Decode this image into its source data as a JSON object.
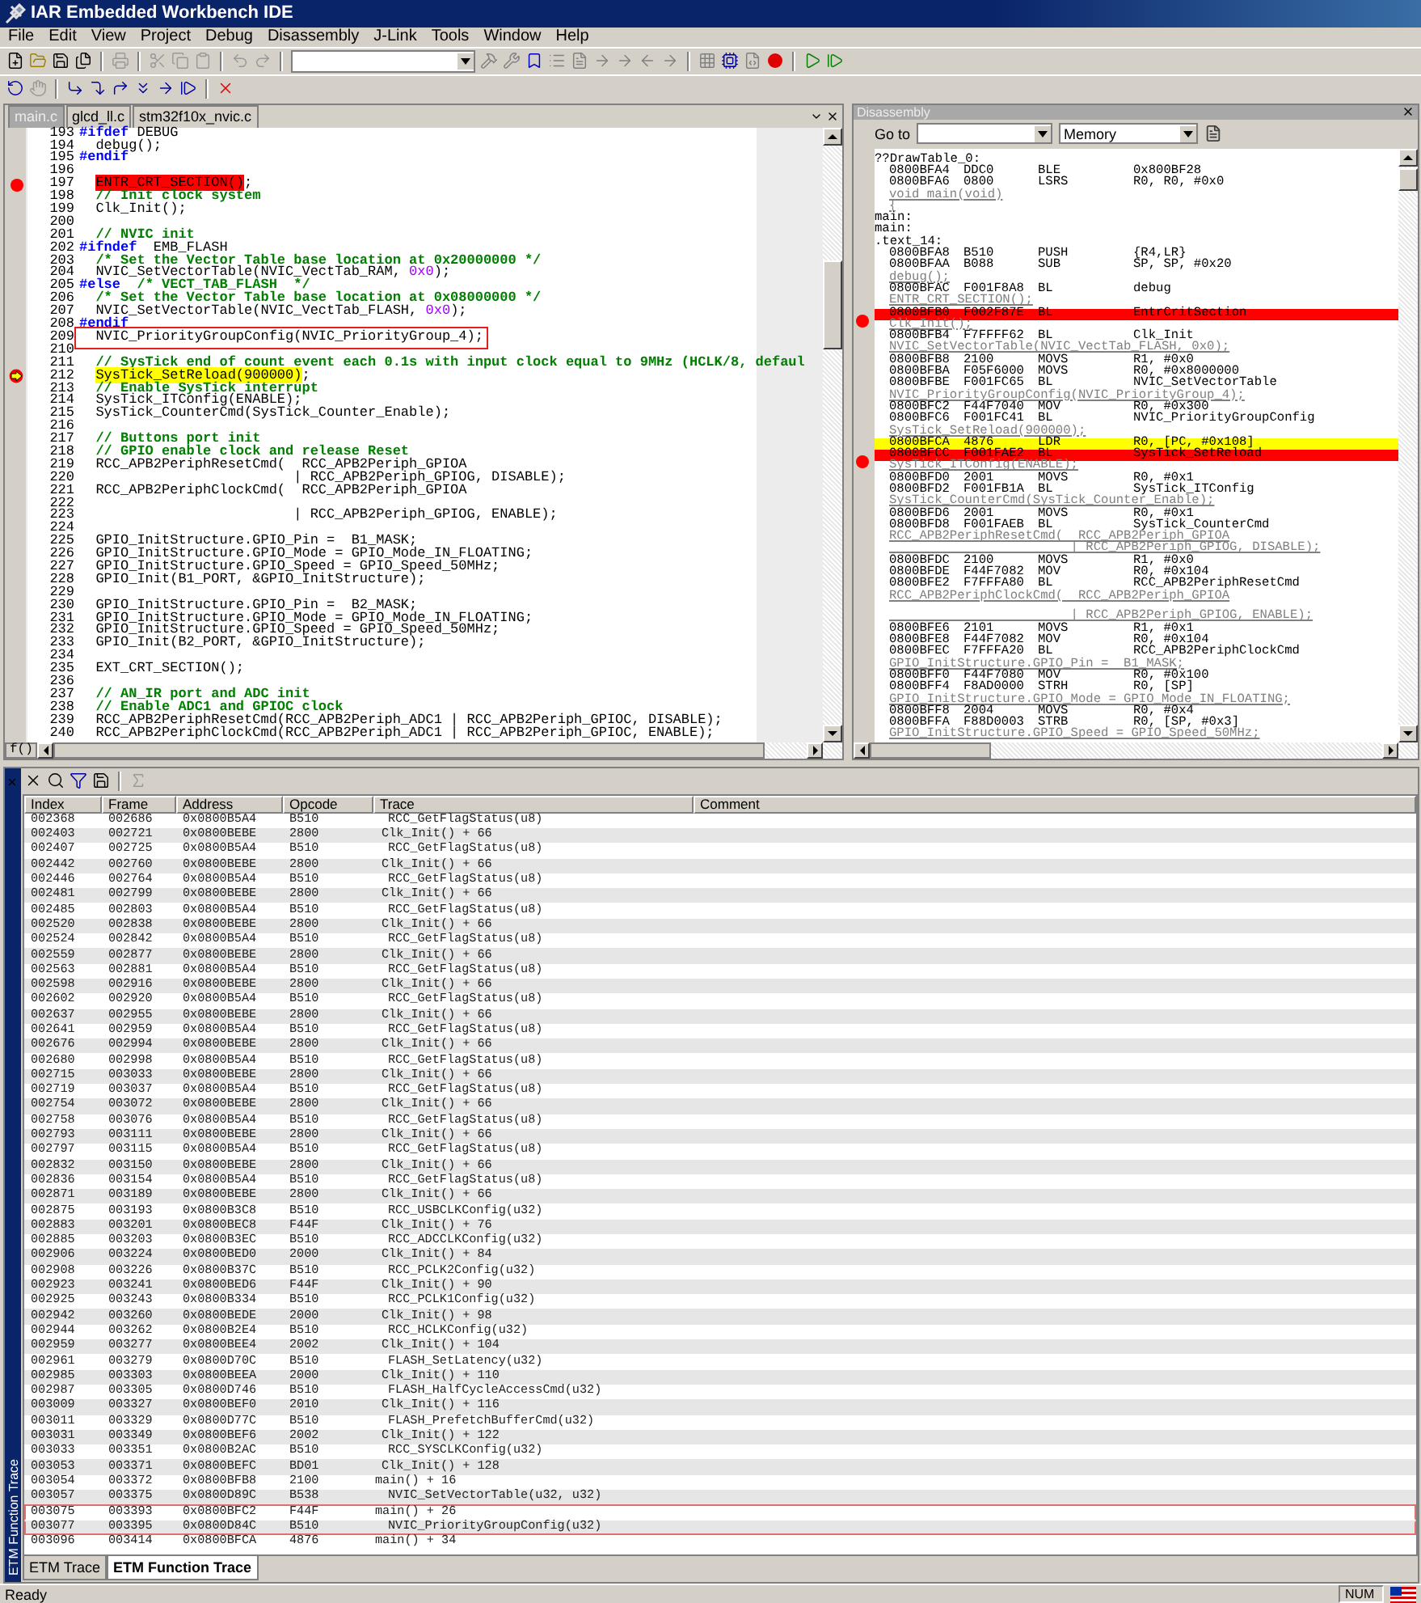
{
  "window": {
    "title": "IAR Embedded Workbench IDE"
  },
  "menu": [
    "File",
    "Edit",
    "View",
    "Project",
    "Debug",
    "Disassembly",
    "J-Link",
    "Tools",
    "Window",
    "Help"
  ],
  "editor": {
    "tabs": [
      {
        "label": "main.c",
        "selected": true
      },
      {
        "label": "glcd_ll.c",
        "selected": false
      },
      {
        "label": "stm32f10x_nvic.c",
        "selected": false
      }
    ],
    "function_button": "f()",
    "lines": [
      {
        "no": "193",
        "parts": [
          {
            "text": "#ifdef",
            "kind": "directive"
          },
          {
            "text": " DEBUG",
            "kind": "plain"
          }
        ]
      },
      {
        "no": "194",
        "parts": [
          {
            "text": "  debug();",
            "kind": "plain"
          }
        ]
      },
      {
        "no": "195",
        "parts": [
          {
            "text": "#endif",
            "kind": "directive"
          }
        ]
      },
      {
        "no": "196"
      },
      {
        "no": "197",
        "breakpoint": true,
        "parts": [
          {
            "text": "  ENTR_CRT_SECTION()",
            "kind": "breakpoint"
          },
          {
            "text": ";",
            "kind": "plain"
          }
        ]
      },
      {
        "no": "198",
        "parts": [
          {
            "text": "  // Init clock system",
            "kind": "comment"
          }
        ]
      },
      {
        "no": "199",
        "parts": [
          {
            "text": "  Clk_Init();",
            "kind": "plain"
          }
        ]
      },
      {
        "no": "200"
      },
      {
        "no": "201",
        "parts": [
          {
            "text": "  // NVIC init",
            "kind": "comment"
          }
        ]
      },
      {
        "no": "202",
        "parts": [
          {
            "text": "#ifndef",
            "kind": "directive"
          },
          {
            "text": "  EMB_FLASH",
            "kind": "plain"
          }
        ]
      },
      {
        "no": "203",
        "parts": [
          {
            "text": "  /* Set the Vector Table base location at 0x20000000 */",
            "kind": "comment"
          }
        ]
      },
      {
        "no": "204",
        "parts": [
          {
            "text": "  NVIC_SetVectorTable(NVIC_VectTab_RAM, ",
            "kind": "plain"
          },
          {
            "text": "0x0",
            "kind": "number"
          },
          {
            "text": ");",
            "kind": "plain"
          }
        ]
      },
      {
        "no": "205",
        "parts": [
          {
            "text": "#else",
            "kind": "directive"
          },
          {
            "text": "  /* VECT_TAB_FLASH  */",
            "kind": "comment"
          }
        ]
      },
      {
        "no": "206",
        "parts": [
          {
            "text": "  /* Set the Vector Table base location at 0x08000000 */",
            "kind": "comment"
          }
        ]
      },
      {
        "no": "207",
        "parts": [
          {
            "text": "  NVIC_SetVectorTable(NVIC_VectTab_FLASH, ",
            "kind": "plain"
          },
          {
            "text": "0x0",
            "kind": "number"
          },
          {
            "text": ");",
            "kind": "plain"
          }
        ]
      },
      {
        "no": "208",
        "parts": [
          {
            "text": "#endif",
            "kind": "directive"
          }
        ]
      },
      {
        "no": "209",
        "boxed": true,
        "parts": [
          {
            "text": "  NVIC_PriorityGroupConfig(NVIC_PriorityGroup_4);",
            "kind": "plain"
          }
        ]
      },
      {
        "no": "210"
      },
      {
        "no": "211",
        "parts": [
          {
            "text": "  // SysTick end of count event each 0.1s with input clock equal to 9MHz (HCLK/8, defaul",
            "kind": "comment"
          }
        ]
      },
      {
        "no": "212",
        "current": true,
        "parts": [
          {
            "text": "  SysTick_SetReload(900000)",
            "kind": "current"
          },
          {
            "text": ";",
            "kind": "plain"
          }
        ]
      },
      {
        "no": "213",
        "parts": [
          {
            "text": "  // Enable SysTick interrupt",
            "kind": "comment"
          }
        ]
      },
      {
        "no": "214",
        "parts": [
          {
            "text": "  SysTick_ITConfig(ENABLE);",
            "kind": "plain"
          }
        ]
      },
      {
        "no": "215",
        "parts": [
          {
            "text": "  SysTick_CounterCmd(SysTick_Counter_Enable);",
            "kind": "plain"
          }
        ]
      },
      {
        "no": "216"
      },
      {
        "no": "217",
        "parts": [
          {
            "text": "  // Buttons port init",
            "kind": "comment"
          }
        ]
      },
      {
        "no": "218",
        "parts": [
          {
            "text": "  // GPIO enable clock and release Reset",
            "kind": "comment"
          }
        ]
      },
      {
        "no": "219",
        "parts": [
          {
            "text": "  RCC_APB2PeriphResetCmd(  RCC_APB2Periph_GPIOA",
            "kind": "plain"
          }
        ]
      },
      {
        "no": "220",
        "parts": [
          {
            "text": "                          | RCC_APB2Periph_GPIOG, DISABLE);",
            "kind": "plain"
          }
        ]
      },
      {
        "no": "221",
        "parts": [
          {
            "text": "  RCC_APB2PeriphClockCmd(  RCC_APB2Periph_GPIOA",
            "kind": "plain"
          }
        ]
      },
      {
        "no": "222"
      },
      {
        "no": "223",
        "parts": [
          {
            "text": "                          | RCC_APB2Periph_GPIOG, ENABLE);",
            "kind": "plain"
          }
        ]
      },
      {
        "no": "224"
      },
      {
        "no": "225",
        "parts": [
          {
            "text": "  GPIO_InitStructure.GPIO_Pin =  B1_MASK;",
            "kind": "plain"
          }
        ]
      },
      {
        "no": "226",
        "parts": [
          {
            "text": "  GPIO_InitStructure.GPIO_Mode = GPIO_Mode_IN_FLOATING;",
            "kind": "plain"
          }
        ]
      },
      {
        "no": "227",
        "parts": [
          {
            "text": "  GPIO_InitStructure.GPIO_Speed = GPIO_Speed_50MHz;",
            "kind": "plain"
          }
        ]
      },
      {
        "no": "228",
        "parts": [
          {
            "text": "  GPIO_Init(B1_PORT, &GPIO_InitStructure);",
            "kind": "plain"
          }
        ]
      },
      {
        "no": "229"
      },
      {
        "no": "230",
        "parts": [
          {
            "text": "  GPIO_InitStructure.GPIO_Pin =  B2_MASK;",
            "kind": "plain"
          }
        ]
      },
      {
        "no": "231",
        "parts": [
          {
            "text": "  GPIO_InitStructure.GPIO_Mode = GPIO_Mode_IN_FLOATING;",
            "kind": "plain"
          }
        ]
      },
      {
        "no": "232",
        "parts": [
          {
            "text": "  GPIO_InitStructure.GPIO_Speed = GPIO_Speed_50MHz;",
            "kind": "plain"
          }
        ]
      },
      {
        "no": "233",
        "parts": [
          {
            "text": "  GPIO_Init(B2_PORT, &GPIO_InitStructure);",
            "kind": "plain"
          }
        ]
      },
      {
        "no": "234"
      },
      {
        "no": "235",
        "parts": [
          {
            "text": "  EXT_CRT_SECTION();",
            "kind": "plain"
          }
        ]
      },
      {
        "no": "236"
      },
      {
        "no": "237",
        "parts": [
          {
            "text": "  // AN_IR port and ADC init",
            "kind": "comment"
          }
        ]
      },
      {
        "no": "238",
        "parts": [
          {
            "text": "  // Enable ADC1 and GPIOC clock",
            "kind": "comment"
          }
        ]
      },
      {
        "no": "239",
        "parts": [
          {
            "text": "  RCC_APB2PeriphResetCmd(RCC_APB2Periph_ADC1 | RCC_APB2Periph_GPIOC, DISABLE);",
            "kind": "plain"
          }
        ]
      },
      {
        "no": "240",
        "parts": [
          {
            "text": "  RCC_APB2PeriphClockCmd(RCC_APB2Periph_ADC1 | RCC_APB2Periph_GPIOC, ENABLE);",
            "kind": "plain"
          }
        ]
      }
    ]
  },
  "disassembly": {
    "title": "Disassembly",
    "goto_label": "Go to",
    "view": "Memory",
    "lines": [
      {
        "kind": "label",
        "text": "??DrawTable_0:"
      },
      {
        "kind": "instr",
        "address": "0800BFA4",
        "opcode": "DDC0",
        "mnemonic": "BLE",
        "operands": "0x800BF28"
      },
      {
        "kind": "instr",
        "address": "0800BFA6",
        "opcode": "0800",
        "mnemonic": "LSRS",
        "operands": "R0, R0, #0x0"
      },
      {
        "kind": "source",
        "text": "void main(void)"
      },
      {
        "kind": "source",
        "text": "{"
      },
      {
        "kind": "label",
        "text": "main:"
      },
      {
        "kind": "label",
        "text": "main:"
      },
      {
        "kind": "label",
        "text": ".text_14:"
      },
      {
        "kind": "instr",
        "address": "0800BFA8",
        "opcode": "B510",
        "mnemonic": "PUSH",
        "operands": "{R4,LR}"
      },
      {
        "kind": "instr",
        "address": "0800BFAA",
        "opcode": "B088",
        "mnemonic": "SUB",
        "operands": "SP, SP, #0x20"
      },
      {
        "kind": "source",
        "text": "debug();"
      },
      {
        "kind": "instr",
        "address": "0800BFAC",
        "opcode": "F001F8A8",
        "mnemonic": "BL",
        "operands": "debug"
      },
      {
        "kind": "source",
        "text": "ENTR_CRT_SECTION();"
      },
      {
        "kind": "instr",
        "address": "0800BFB0",
        "opcode": "F002F87E",
        "mnemonic": "BL",
        "operands": "EntrCritSection",
        "breakpoint": true
      },
      {
        "kind": "source",
        "text": "Clk_Init();"
      },
      {
        "kind": "instr",
        "address": "0800BFB4",
        "opcode": "F7FFFF62",
        "mnemonic": "BL",
        "operands": "Clk_Init"
      },
      {
        "kind": "source",
        "text": "NVIC_SetVectorTable(NVIC_VectTab_FLASH, 0x0);"
      },
      {
        "kind": "instr",
        "address": "0800BFB8",
        "opcode": "2100",
        "mnemonic": "MOVS",
        "operands": "R1, #0x0"
      },
      {
        "kind": "instr",
        "address": "0800BFBA",
        "opcode": "F05F6000",
        "mnemonic": "MOVS",
        "operands": "R0, #0x8000000"
      },
      {
        "kind": "instr",
        "address": "0800BFBE",
        "opcode": "F001FC65",
        "mnemonic": "BL",
        "operands": "NVIC_SetVectorTable"
      },
      {
        "kind": "source",
        "text": "NVIC_PriorityGroupConfig(NVIC_PriorityGroup_4);"
      },
      {
        "kind": "instr",
        "address": "0800BFC2",
        "opcode": "F44F7040",
        "mnemonic": "MOV",
        "operands": "R0, #0x300"
      },
      {
        "kind": "instr",
        "address": "0800BFC6",
        "opcode": "F001FC41",
        "mnemonic": "BL",
        "operands": "NVIC_PriorityGroupConfig"
      },
      {
        "kind": "source",
        "text": "SysTick_SetReload(900000);"
      },
      {
        "kind": "instr",
        "address": "0800BFCA",
        "opcode": "4876",
        "mnemonic": "LDR",
        "operands": "R0, [PC, #0x108]",
        "current": true
      },
      {
        "kind": "instr",
        "address": "0800BFCC",
        "opcode": "F001FAE2",
        "mnemonic": "BL",
        "operands": "SysTick_SetReload",
        "breakpoint": true
      },
      {
        "kind": "source",
        "text": "SysTick_ITConfig(ENABLE);"
      },
      {
        "kind": "instr",
        "address": "0800BFD0",
        "opcode": "2001",
        "mnemonic": "MOVS",
        "operands": "R0, #0x1"
      },
      {
        "kind": "instr",
        "address": "0800BFD2",
        "opcode": "F001FB1A",
        "mnemonic": "BL",
        "operands": "SysTick_ITConfig"
      },
      {
        "kind": "source",
        "text": "SysTick_CounterCmd(SysTick_Counter_Enable);"
      },
      {
        "kind": "instr",
        "address": "0800BFD6",
        "opcode": "2001",
        "mnemonic": "MOVS",
        "operands": "R0, #0x1"
      },
      {
        "kind": "instr",
        "address": "0800BFD8",
        "opcode": "F001FAEB",
        "mnemonic": "BL",
        "operands": "SysTick_CounterCmd"
      },
      {
        "kind": "source",
        "text": "RCC_APB2PeriphResetCmd(  RCC_APB2Periph_GPIOA"
      },
      {
        "kind": "source",
        "text": "                        | RCC_APB2Periph_GPIOG, DISABLE);"
      },
      {
        "kind": "instr",
        "address": "0800BFDC",
        "opcode": "2100",
        "mnemonic": "MOVS",
        "operands": "R1, #0x0"
      },
      {
        "kind": "instr",
        "address": "0800BFDE",
        "opcode": "F44F7082",
        "mnemonic": "MOV",
        "operands": "R0, #0x104"
      },
      {
        "kind": "instr",
        "address": "0800BFE2",
        "opcode": "F7FFFA80",
        "mnemonic": "BL",
        "operands": "RCC_APB2PeriphResetCmd"
      },
      {
        "kind": "source",
        "text": "RCC_APB2PeriphClockCmd(  RCC_APB2Periph_GPIOA"
      },
      {
        "kind": "blank"
      },
      {
        "kind": "source",
        "text": "                        | RCC_APB2Periph_GPIOG, ENABLE);"
      },
      {
        "kind": "instr",
        "address": "0800BFE6",
        "opcode": "2101",
        "mnemonic": "MOVS",
        "operands": "R1, #0x1"
      },
      {
        "kind": "instr",
        "address": "0800BFE8",
        "opcode": "F44F7082",
        "mnemonic": "MOV",
        "operands": "R0, #0x104"
      },
      {
        "kind": "instr",
        "address": "0800BFEC",
        "opcode": "F7FFFA20",
        "mnemonic": "BL",
        "operands": "RCC_APB2PeriphClockCmd"
      },
      {
        "kind": "source",
        "text": "GPIO_InitStructure.GPIO_Pin =  B1_MASK;"
      },
      {
        "kind": "instr",
        "address": "0800BFF0",
        "opcode": "F44F7080",
        "mnemonic": "MOV",
        "operands": "R0, #0x100"
      },
      {
        "kind": "instr",
        "address": "0800BFF4",
        "opcode": "F8AD0000",
        "mnemonic": "STRH",
        "operands": "R0, [SP]"
      },
      {
        "kind": "source",
        "text": "GPIO_InitStructure.GPIO_Mode = GPIO_Mode_IN_FLOATING;"
      },
      {
        "kind": "instr",
        "address": "0800BFF8",
        "opcode": "2004",
        "mnemonic": "MOVS",
        "operands": "R0, #0x4"
      },
      {
        "kind": "instr",
        "address": "0800BFFA",
        "opcode": "F88D0003",
        "mnemonic": "STRB",
        "operands": "R0, [SP, #0x3]"
      },
      {
        "kind": "source",
        "text": "GPIO_InitStructure.GPIO_Speed = GPIO_Speed_50MHz;"
      }
    ]
  },
  "trace": {
    "side_title": "ETM Function Trace",
    "columns": [
      "Index",
      "Frame",
      "Address",
      "Opcode",
      "Trace",
      "Comment"
    ],
    "rows": [
      {
        "index": "002368",
        "frame": "002686",
        "address": "0x0800B5A4",
        "opcode": "B510",
        "trace": "RCC_GetFlagStatus(u8)",
        "kind": "callee"
      },
      {
        "index": "002403",
        "frame": "002721",
        "address": "0x0800BEBE",
        "opcode": "2800",
        "trace": "Clk_Init() + 66",
        "kind": "caller"
      },
      {
        "index": "002407",
        "frame": "002725",
        "address": "0x0800B5A4",
        "opcode": "B510",
        "trace": "RCC_GetFlagStatus(u8)",
        "kind": "callee"
      },
      {
        "index": "002442",
        "frame": "002760",
        "address": "0x0800BEBE",
        "opcode": "2800",
        "trace": "Clk_Init() + 66",
        "kind": "caller"
      },
      {
        "index": "002446",
        "frame": "002764",
        "address": "0x0800B5A4",
        "opcode": "B510",
        "trace": "RCC_GetFlagStatus(u8)",
        "kind": "callee"
      },
      {
        "index": "002481",
        "frame": "002799",
        "address": "0x0800BEBE",
        "opcode": "2800",
        "trace": "Clk_Init() + 66",
        "kind": "caller"
      },
      {
        "index": "002485",
        "frame": "002803",
        "address": "0x0800B5A4",
        "opcode": "B510",
        "trace": "RCC_GetFlagStatus(u8)",
        "kind": "callee"
      },
      {
        "index": "002520",
        "frame": "002838",
        "address": "0x0800BEBE",
        "opcode": "2800",
        "trace": "Clk_Init() + 66",
        "kind": "caller"
      },
      {
        "index": "002524",
        "frame": "002842",
        "address": "0x0800B5A4",
        "opcode": "B510",
        "trace": "RCC_GetFlagStatus(u8)",
        "kind": "callee"
      },
      {
        "index": "002559",
        "frame": "002877",
        "address": "0x0800BEBE",
        "opcode": "2800",
        "trace": "Clk_Init() + 66",
        "kind": "caller"
      },
      {
        "index": "002563",
        "frame": "002881",
        "address": "0x0800B5A4",
        "opcode": "B510",
        "trace": "RCC_GetFlagStatus(u8)",
        "kind": "callee"
      },
      {
        "index": "002598",
        "frame": "002916",
        "address": "0x0800BEBE",
        "opcode": "2800",
        "trace": "Clk_Init() + 66",
        "kind": "caller"
      },
      {
        "index": "002602",
        "frame": "002920",
        "address": "0x0800B5A4",
        "opcode": "B510",
        "trace": "RCC_GetFlagStatus(u8)",
        "kind": "callee"
      },
      {
        "index": "002637",
        "frame": "002955",
        "address": "0x0800BEBE",
        "opcode": "2800",
        "trace": "Clk_Init() + 66",
        "kind": "caller"
      },
      {
        "index": "002641",
        "frame": "002959",
        "address": "0x0800B5A4",
        "opcode": "B510",
        "trace": "RCC_GetFlagStatus(u8)",
        "kind": "callee"
      },
      {
        "index": "002676",
        "frame": "002994",
        "address": "0x0800BEBE",
        "opcode": "2800",
        "trace": "Clk_Init() + 66",
        "kind": "caller"
      },
      {
        "index": "002680",
        "frame": "002998",
        "address": "0x0800B5A4",
        "opcode": "B510",
        "trace": "RCC_GetFlagStatus(u8)",
        "kind": "callee"
      },
      {
        "index": "002715",
        "frame": "003033",
        "address": "0x0800BEBE",
        "opcode": "2800",
        "trace": "Clk_Init() + 66",
        "kind": "caller"
      },
      {
        "index": "002719",
        "frame": "003037",
        "address": "0x0800B5A4",
        "opcode": "B510",
        "trace": "RCC_GetFlagStatus(u8)",
        "kind": "callee"
      },
      {
        "index": "002754",
        "frame": "003072",
        "address": "0x0800BEBE",
        "opcode": "2800",
        "trace": "Clk_Init() + 66",
        "kind": "caller"
      },
      {
        "index": "002758",
        "frame": "003076",
        "address": "0x0800B5A4",
        "opcode": "B510",
        "trace": "RCC_GetFlagStatus(u8)",
        "kind": "callee"
      },
      {
        "index": "002793",
        "frame": "003111",
        "address": "0x0800BEBE",
        "opcode": "2800",
        "trace": "Clk_Init() + 66",
        "kind": "caller"
      },
      {
        "index": "002797",
        "frame": "003115",
        "address": "0x0800B5A4",
        "opcode": "B510",
        "trace": "RCC_GetFlagStatus(u8)",
        "kind": "callee"
      },
      {
        "index": "002832",
        "frame": "003150",
        "address": "0x0800BEBE",
        "opcode": "2800",
        "trace": "Clk_Init() + 66",
        "kind": "caller"
      },
      {
        "index": "002836",
        "frame": "003154",
        "address": "0x0800B5A4",
        "opcode": "B510",
        "trace": "RCC_GetFlagStatus(u8)",
        "kind": "callee"
      },
      {
        "index": "002871",
        "frame": "003189",
        "address": "0x0800BEBE",
        "opcode": "2800",
        "trace": "Clk_Init() + 66",
        "kind": "caller"
      },
      {
        "index": "002875",
        "frame": "003193",
        "address": "0x0800B3C8",
        "opcode": "B510",
        "trace": "RCC_USBCLKConfig(u32)",
        "kind": "callee"
      },
      {
        "index": "002883",
        "frame": "003201",
        "address": "0x0800BEC8",
        "opcode": "F44F",
        "trace": "Clk_Init() + 76",
        "kind": "caller"
      },
      {
        "index": "002885",
        "frame": "003203",
        "address": "0x0800B3EC",
        "opcode": "B510",
        "trace": "RCC_ADCCLKConfig(u32)",
        "kind": "callee"
      },
      {
        "index": "002906",
        "frame": "003224",
        "address": "0x0800BED0",
        "opcode": "2000",
        "trace": "Clk_Init() + 84",
        "kind": "caller"
      },
      {
        "index": "002908",
        "frame": "003226",
        "address": "0x0800B37C",
        "opcode": "B510",
        "trace": "RCC_PCLK2Config(u32)",
        "kind": "callee"
      },
      {
        "index": "002923",
        "frame": "003241",
        "address": "0x0800BED6",
        "opcode": "F44F",
        "trace": "Clk_Init() + 90",
        "kind": "caller"
      },
      {
        "index": "002925",
        "frame": "003243",
        "address": "0x0800B334",
        "opcode": "B510",
        "trace": "RCC_PCLK1Config(u32)",
        "kind": "callee"
      },
      {
        "index": "002942",
        "frame": "003260",
        "address": "0x0800BEDE",
        "opcode": "2000",
        "trace": "Clk_Init() + 98",
        "kind": "caller"
      },
      {
        "index": "002944",
        "frame": "003262",
        "address": "0x0800B2E4",
        "opcode": "B510",
        "trace": "RCC_HCLKConfig(u32)",
        "kind": "callee"
      },
      {
        "index": "002959",
        "frame": "003277",
        "address": "0x0800BEE4",
        "opcode": "2002",
        "trace": "Clk_Init() + 104",
        "kind": "caller"
      },
      {
        "index": "002961",
        "frame": "003279",
        "address": "0x0800D70C",
        "opcode": "B510",
        "trace": "FLASH_SetLatency(u32)",
        "kind": "callee"
      },
      {
        "index": "002985",
        "frame": "003303",
        "address": "0x0800BEEA",
        "opcode": "2000",
        "trace": "Clk_Init() + 110",
        "kind": "caller"
      },
      {
        "index": "002987",
        "frame": "003305",
        "address": "0x0800D746",
        "opcode": "B510",
        "trace": "FLASH_HalfCycleAccessCmd(u32)",
        "kind": "callee"
      },
      {
        "index": "003009",
        "frame": "003327",
        "address": "0x0800BEF0",
        "opcode": "2010",
        "trace": "Clk_Init() + 116",
        "kind": "caller"
      },
      {
        "index": "003011",
        "frame": "003329",
        "address": "0x0800D77C",
        "opcode": "B510",
        "trace": "FLASH_PrefetchBufferCmd(u32)",
        "kind": "callee"
      },
      {
        "index": "003031",
        "frame": "003349",
        "address": "0x0800BEF6",
        "opcode": "2002",
        "trace": "Clk_Init() + 122",
        "kind": "caller"
      },
      {
        "index": "003033",
        "frame": "003351",
        "address": "0x0800B2AC",
        "opcode": "B510",
        "trace": "RCC_SYSCLKConfig(u32)",
        "kind": "callee"
      },
      {
        "index": "003053",
        "frame": "003371",
        "address": "0x0800BEFC",
        "opcode": "BD01",
        "trace": "Clk_Init() + 128",
        "kind": "caller"
      },
      {
        "index": "003054",
        "frame": "003372",
        "address": "0x0800BFB8",
        "opcode": "2100",
        "trace": "main() + 16",
        "kind": "root"
      },
      {
        "index": "003057",
        "frame": "003375",
        "address": "0x0800D89C",
        "opcode": "B538",
        "trace": "NVIC_SetVectorTable(u32, u32)",
        "kind": "callee"
      },
      {
        "index": "003075",
        "frame": "003393",
        "address": "0x0800BFC2",
        "opcode": "F44F",
        "trace": "main() + 26",
        "kind": "root",
        "boxed": true
      },
      {
        "index": "003077",
        "frame": "003395",
        "address": "0x0800D84C",
        "opcode": "B510",
        "trace": "NVIC_PriorityGroupConfig(u32)",
        "kind": "callee",
        "boxed": true
      },
      {
        "index": "003096",
        "frame": "003414",
        "address": "0x0800BFCA",
        "opcode": "4876",
        "trace": "main() + 34",
        "kind": "root"
      }
    ],
    "tabs": [
      {
        "label": "ETM Trace",
        "selected": false
      },
      {
        "label": "ETM Function Trace",
        "selected": true
      }
    ]
  },
  "status_bar": {
    "text": "Ready",
    "indicator": "NUM"
  }
}
